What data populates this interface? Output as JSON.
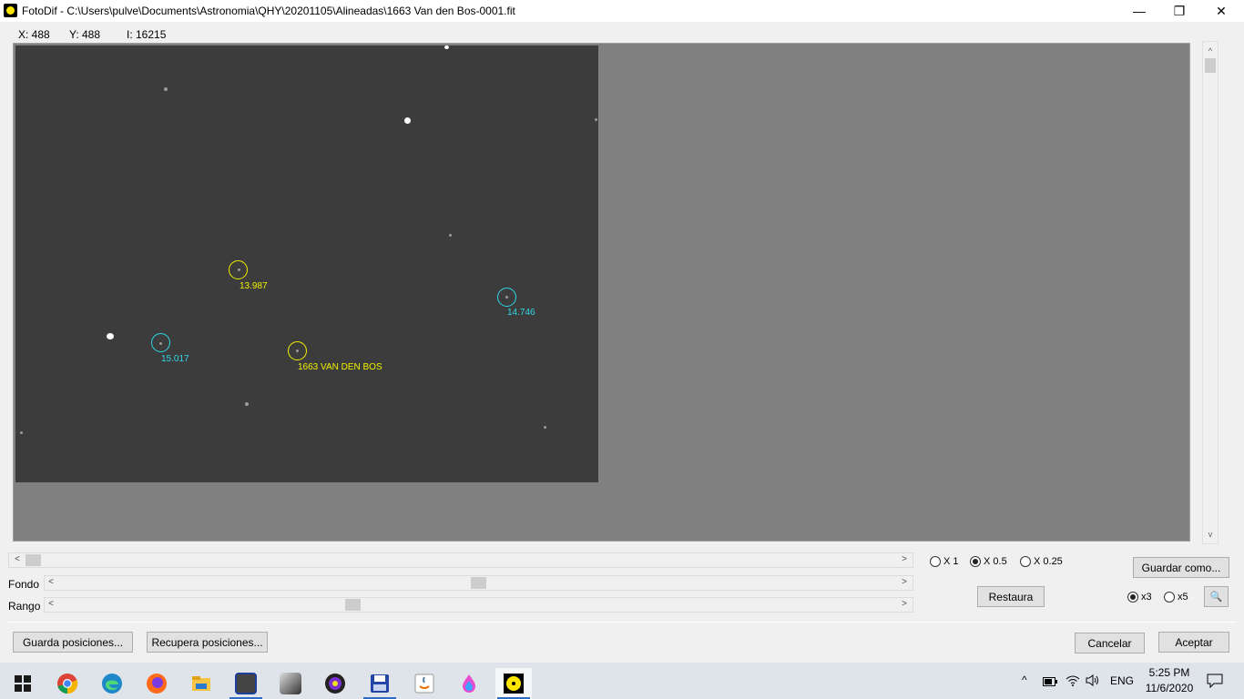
{
  "window": {
    "title": "FotoDif - C:\\Users\\pulve\\Documents\\Astronomia\\QHY\\20201105\\Alineadas\\1663 Van den Bos-0001.fit",
    "minimize_glyph": "—",
    "maximize_glyph": "❐",
    "close_glyph": "✕"
  },
  "readout": {
    "x": "X: 488",
    "y": "Y: 488",
    "intensity": "I: 16215"
  },
  "markers": [
    {
      "label": "13.987",
      "color": "yellow"
    },
    {
      "label": "14.746",
      "color": "cyan"
    },
    {
      "label": "15.017",
      "color": "cyan"
    },
    {
      "label": "1663 VAN DEN BOS",
      "color": "yellow"
    }
  ],
  "sliders": {
    "fondo_label": "Fondo",
    "rango_label": "Rango",
    "left_arrow": "<",
    "right_arrow": ">",
    "up_arrow": "^",
    "down_arrow": "v"
  },
  "zoom_options": [
    {
      "label": "X 1",
      "selected": false
    },
    {
      "label": "X 0.5",
      "selected": true
    },
    {
      "label": "X 0.25",
      "selected": false
    }
  ],
  "magnifier_options": [
    {
      "label": "x3",
      "selected": true
    },
    {
      "label": "x5",
      "selected": false
    }
  ],
  "buttons": {
    "guardar_como": "Guardar como...",
    "restaura": "Restaura",
    "guarda_posiciones": "Guarda posiciones...",
    "recupera_posiciones": "Recupera posiciones...",
    "cancelar": "Cancelar",
    "aceptar": "Aceptar",
    "magnifier_icon": "🔍"
  },
  "taskbar": {
    "apps": [
      "windows-start-icon",
      "chrome-icon",
      "edge-icon",
      "firefox-icon",
      "file-explorer-icon",
      "app-icon-1",
      "app-icon-2",
      "app-icon-3",
      "floppy-save-icon",
      "java-icon",
      "app-drop-icon",
      "fotodif-icon"
    ],
    "language": "ENG",
    "time": "5:25 PM",
    "date": "11/6/2020",
    "tray_up_glyph": "^"
  }
}
